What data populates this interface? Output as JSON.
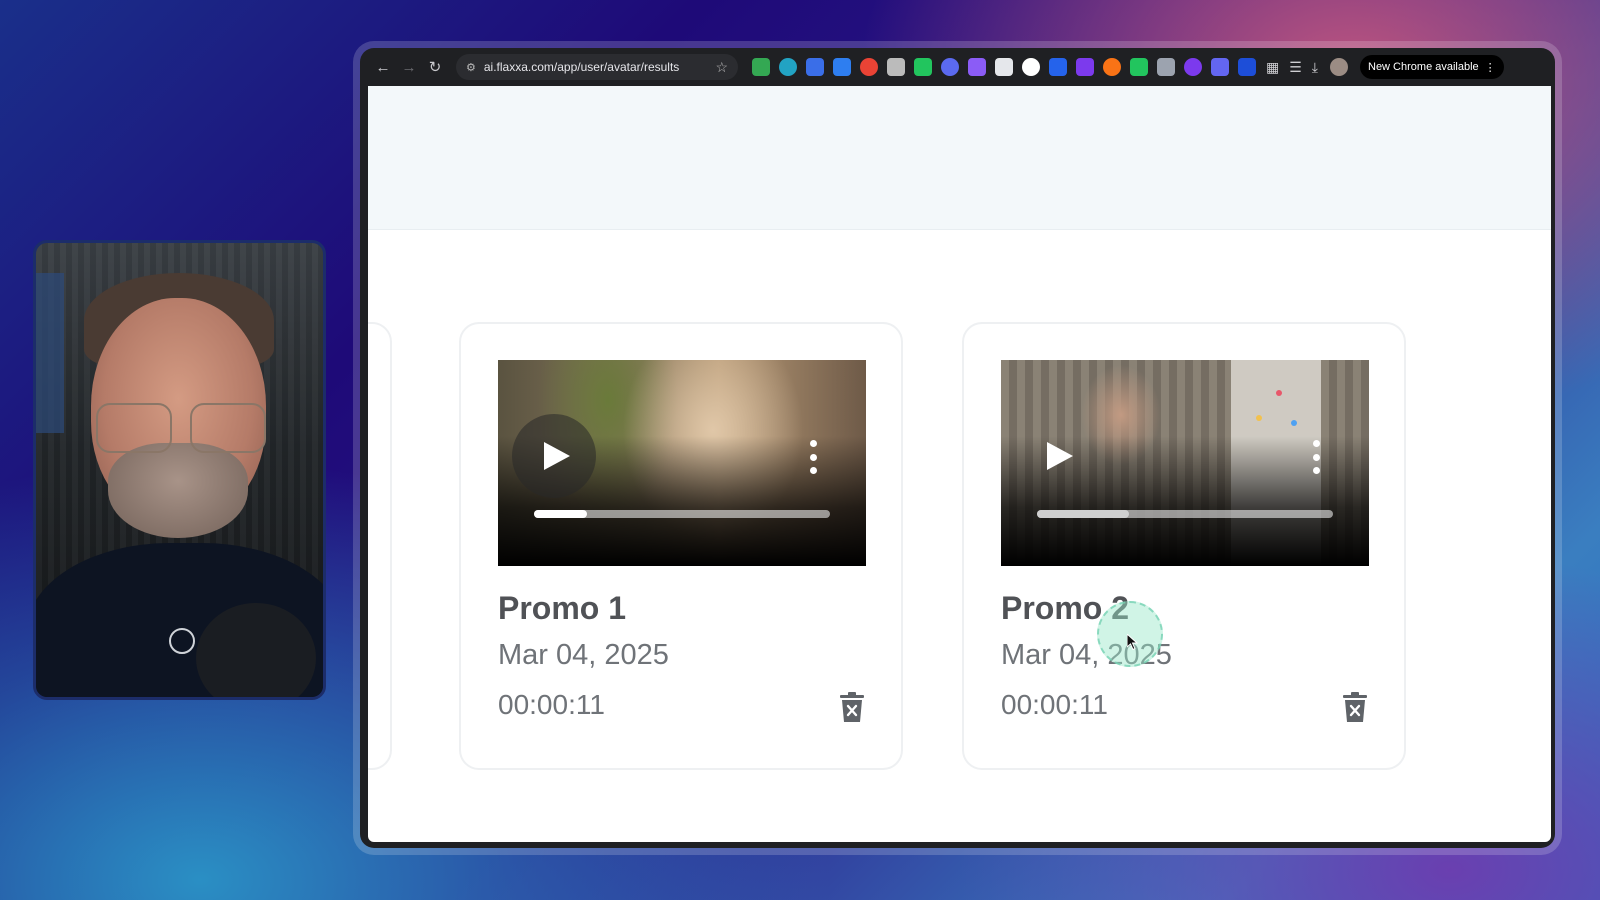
{
  "browser": {
    "url": "ai.flaxxa.com/app/user/avatar/results",
    "update_label": "New Chrome available",
    "extension_colors": [
      "#34a853",
      "#22a3c3",
      "#3a6ee8",
      "#2e7ef0",
      "#ea4335",
      "#bbbbbb",
      "#22c55e",
      "#5b6af0",
      "#8b5cf6",
      "#e5e7eb",
      "#ffffff",
      "#2563eb",
      "#7c3aed",
      "#f97316",
      "#22c55e",
      "#9ca3af",
      "#7c3aed",
      "#6366f1",
      "#1d4ed8"
    ]
  },
  "cards": [
    {
      "title": "Promo 1",
      "date": "Mar 04, 2025",
      "duration": "00:00:11",
      "progress": 0.18
    },
    {
      "title": "Promo 2",
      "date": "Mar 04, 2025",
      "duration": "00:00:11",
      "progress": 0.31
    }
  ]
}
